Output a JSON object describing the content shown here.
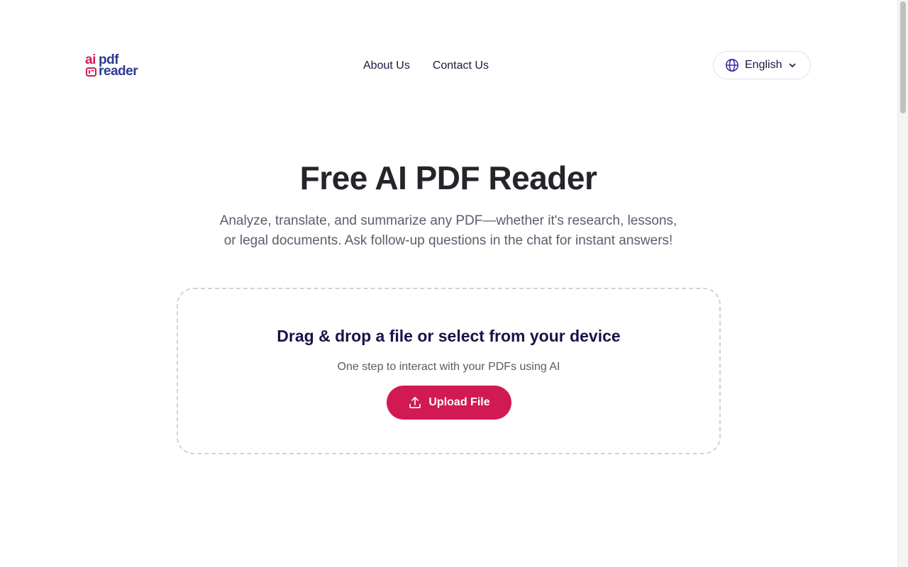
{
  "brand": {
    "logo_ai": "ai",
    "logo_pdf": "pdf",
    "logo_reader": "reader",
    "color_accent": "#d41a55",
    "color_primary": "#2b3a8f"
  },
  "nav": {
    "items": [
      {
        "label": "About Us"
      },
      {
        "label": "Contact Us"
      }
    ]
  },
  "language": {
    "selected": "English",
    "icon": "globe-icon",
    "chevron": "chevron-down-icon"
  },
  "hero": {
    "title": "Free AI PDF Reader",
    "subtitle": "Analyze, translate, and summarize any PDF—whether it's research, lessons, or legal documents. Ask follow-up questions in the chat for instant answers!"
  },
  "upload": {
    "title": "Drag & drop a file or select from your device",
    "subtitle": "One step to interact with your PDFs using AI",
    "button_label": "Upload File",
    "button_icon": "upload-icon",
    "button_color": "#d21a52"
  }
}
